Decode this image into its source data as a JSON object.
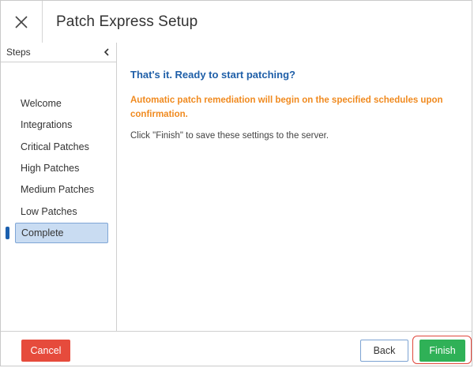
{
  "window": {
    "title": "Patch Express Setup",
    "close_icon": "close-icon"
  },
  "sidebar": {
    "heading": "Steps",
    "collapse_icon": "chevron-left-icon",
    "items": [
      {
        "label": "Welcome"
      },
      {
        "label": "Integrations"
      },
      {
        "label": "Critical Patches"
      },
      {
        "label": "High Patches"
      },
      {
        "label": "Medium Patches"
      },
      {
        "label": "Low Patches"
      },
      {
        "label": "Complete",
        "active": true
      }
    ]
  },
  "main": {
    "heading": "That's it. Ready to start patching?",
    "warning": "Automatic patch remediation will begin on the specified schedules upon confirmation.",
    "info": "Click \"Finish\" to save these settings to the server."
  },
  "footer": {
    "cancel_label": "Cancel",
    "back_label": "Back",
    "finish_label": "Finish"
  },
  "colors": {
    "heading_blue": "#1f5fa8",
    "warning_orange": "#f08a1f",
    "cancel_red": "#e64b3c",
    "finish_green": "#2fb157",
    "active_step_bg": "#c9dcf2"
  }
}
